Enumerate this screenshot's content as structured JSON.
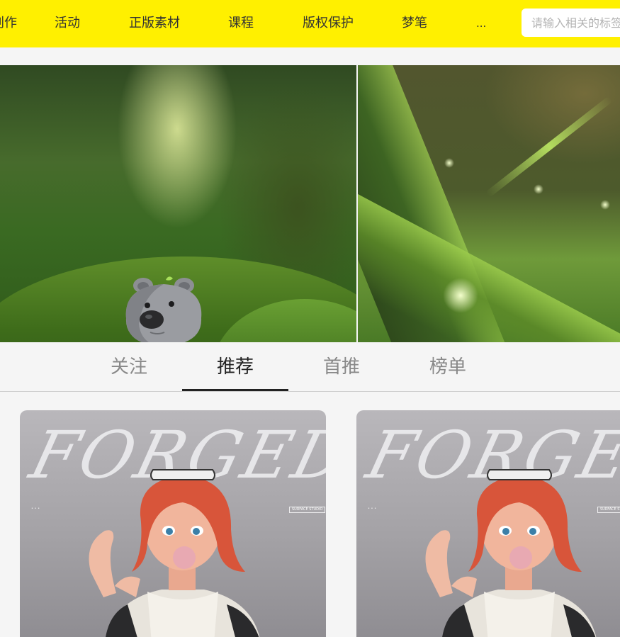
{
  "nav": {
    "items": [
      {
        "label": "创作"
      },
      {
        "label": "活动"
      },
      {
        "label": "正版素材"
      },
      {
        "label": "课程"
      },
      {
        "label": "版权保护"
      },
      {
        "label": "梦笔"
      },
      {
        "label": "..."
      }
    ],
    "search_placeholder": "请输入相关的标签"
  },
  "banner": {
    "left_image_icon": "bear-in-grass-image",
    "right_image_icon": "mossy-ridge-image"
  },
  "tabs": [
    {
      "label": "关注",
      "active": false
    },
    {
      "label": "推荐",
      "active": true
    },
    {
      "label": "首推",
      "active": false
    },
    {
      "label": "榜单",
      "active": false
    }
  ],
  "cards": [
    {
      "title": "FORGED",
      "icon": "girl-with-bubblegum-image",
      "badge": "SURFACE STUDIO"
    },
    {
      "title": "FORGED",
      "icon": "girl-with-bubblegum-image",
      "badge": "SURFACE STUDIO"
    }
  ],
  "colors": {
    "accent": "#fff000",
    "tab_active": "#222222",
    "tab_inactive": "#888888"
  }
}
